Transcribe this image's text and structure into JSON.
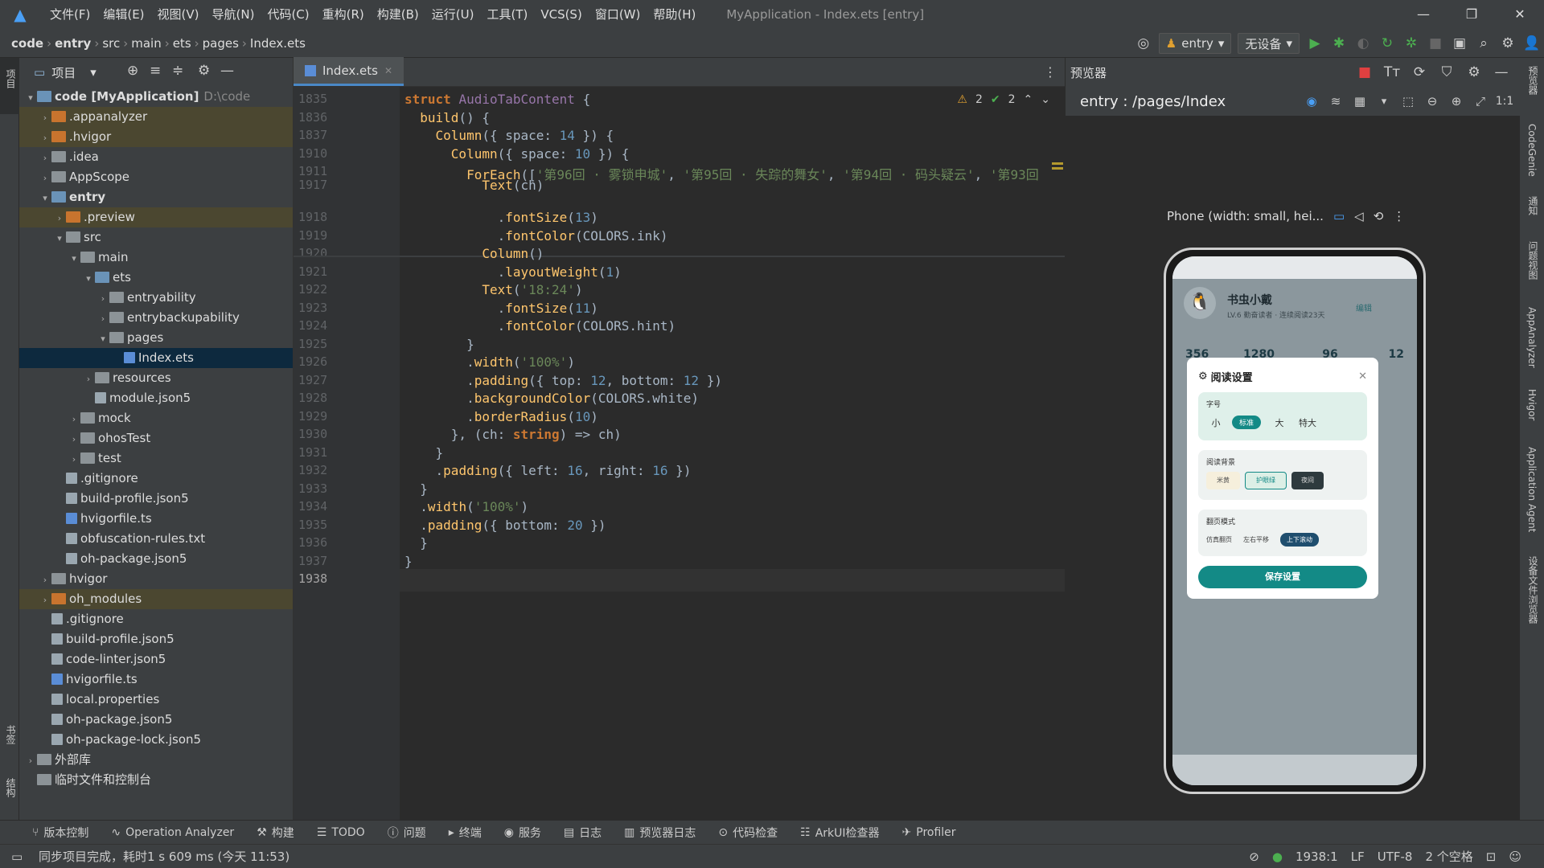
{
  "menubar": {
    "items": [
      "文件(F)",
      "编辑(E)",
      "视图(V)",
      "导航(N)",
      "代码(C)",
      "重构(R)",
      "构建(B)",
      "运行(U)",
      "工具(T)",
      "VCS(S)",
      "窗口(W)",
      "帮助(H)"
    ],
    "title": "MyApplication - Index.ets [entry]"
  },
  "breadcrumb": [
    "code",
    "entry",
    "src",
    "main",
    "ets",
    "pages",
    "Index.ets"
  ],
  "toolbar": {
    "module": "entry",
    "device": "无设备"
  },
  "project": {
    "header": "项目",
    "rows": [
      {
        "indent": 0,
        "arrow": "▾",
        "icon": "fold bl",
        "label": "code [MyApplication]",
        "sub": "D:\\code",
        "bold": true
      },
      {
        "indent": 1,
        "arrow": "›",
        "icon": "fold or",
        "label": ".appanalyzer",
        "hl": true
      },
      {
        "indent": 1,
        "arrow": "›",
        "icon": "fold or",
        "label": ".hvigor",
        "hl": true
      },
      {
        "indent": 1,
        "arrow": "›",
        "icon": "fold",
        "label": ".idea"
      },
      {
        "indent": 1,
        "arrow": "›",
        "icon": "fold",
        "label": "AppScope"
      },
      {
        "indent": 1,
        "arrow": "▾",
        "icon": "fold bl",
        "label": "entry",
        "bold": true
      },
      {
        "indent": 2,
        "arrow": "›",
        "icon": "fold or",
        "label": ".preview",
        "hl": true
      },
      {
        "indent": 2,
        "arrow": "▾",
        "icon": "fold",
        "label": "src"
      },
      {
        "indent": 3,
        "arrow": "▾",
        "icon": "fold",
        "label": "main"
      },
      {
        "indent": 4,
        "arrow": "▾",
        "icon": "fold bl",
        "label": "ets"
      },
      {
        "indent": 5,
        "arrow": "›",
        "icon": "fold",
        "label": "entryability"
      },
      {
        "indent": 5,
        "arrow": "›",
        "icon": "fold",
        "label": "entrybackupability"
      },
      {
        "indent": 5,
        "arrow": "▾",
        "icon": "fold",
        "label": "pages"
      },
      {
        "indent": 6,
        "arrow": "",
        "icon": "file ts",
        "label": "Index.ets",
        "sel": true
      },
      {
        "indent": 4,
        "arrow": "›",
        "icon": "fold",
        "label": "resources"
      },
      {
        "indent": 4,
        "arrow": "",
        "icon": "file",
        "label": "module.json5"
      },
      {
        "indent": 3,
        "arrow": "›",
        "icon": "fold",
        "label": "mock"
      },
      {
        "indent": 3,
        "arrow": "›",
        "icon": "fold",
        "label": "ohosTest"
      },
      {
        "indent": 3,
        "arrow": "›",
        "icon": "fold",
        "label": "test"
      },
      {
        "indent": 2,
        "arrow": "",
        "icon": "file",
        "label": ".gitignore"
      },
      {
        "indent": 2,
        "arrow": "",
        "icon": "file",
        "label": "build-profile.json5"
      },
      {
        "indent": 2,
        "arrow": "",
        "icon": "file ts",
        "label": "hvigorfile.ts"
      },
      {
        "indent": 2,
        "arrow": "",
        "icon": "file",
        "label": "obfuscation-rules.txt"
      },
      {
        "indent": 2,
        "arrow": "",
        "icon": "file",
        "label": "oh-package.json5"
      },
      {
        "indent": 1,
        "arrow": "›",
        "icon": "fold",
        "label": "hvigor"
      },
      {
        "indent": 1,
        "arrow": "›",
        "icon": "fold or",
        "label": "oh_modules",
        "hl": true
      },
      {
        "indent": 1,
        "arrow": "",
        "icon": "file",
        "label": ".gitignore"
      },
      {
        "indent": 1,
        "arrow": "",
        "icon": "file",
        "label": "build-profile.json5"
      },
      {
        "indent": 1,
        "arrow": "",
        "icon": "file",
        "label": "code-linter.json5"
      },
      {
        "indent": 1,
        "arrow": "",
        "icon": "file ts",
        "label": "hvigorfile.ts"
      },
      {
        "indent": 1,
        "arrow": "",
        "icon": "file",
        "label": "local.properties"
      },
      {
        "indent": 1,
        "arrow": "",
        "icon": "file",
        "label": "oh-package.json5"
      },
      {
        "indent": 1,
        "arrow": "",
        "icon": "file",
        "label": "oh-package-lock.json5"
      },
      {
        "indent": 0,
        "arrow": "›",
        "icon": "fold",
        "label": "外部库"
      },
      {
        "indent": 0,
        "arrow": "",
        "icon": "fold",
        "label": "临时文件和控制台"
      }
    ]
  },
  "editor": {
    "tab": "Index.ets",
    "inspections": {
      "warn": "2",
      "ok": "2"
    },
    "lines": [
      "1835",
      "1836",
      "1837",
      "1910",
      "1911",
      "1917",
      "1918",
      "1919",
      "1920",
      "1921",
      "1922",
      "1923",
      "1924",
      "1925",
      "1926",
      "1927",
      "1928",
      "1929",
      "1930",
      "1931",
      "1932",
      "1933",
      "1934",
      "1935",
      "1936",
      "1937",
      "1938"
    ],
    "code": [
      "<span class='kw'>struct</span> <span class='pu'>AudioTabContent</span> {",
      "  <span class='fn'>build</span>() {",
      "    <span class='fn'>Column</span>({ space: <span class='num'>14</span> }) {",
      "      <span class='fn'>Column</span>({ space: <span class='num'>10</span> }) {",
      "        <span class='fn'>ForEach</span>([<span class='str'>'第96回 · 雾锁申城'</span>, <span class='str'>'第95回 · 失踪的舞女'</span>, <span class='str'>'第94回 · 码头疑云'</span>, <span class='str'>'第93回</span>",
      "          <span class='fn'>Text</span>(ch)",
      "            .<span class='dot'>fontSize</span>(<span class='num'>13</span>)",
      "            .<span class='dot'>fontColor</span>(COLORS.ink)",
      "          <span class='fn'>Column</span>()",
      "            .<span class='dot'>layoutWeight</span>(<span class='num'>1</span>)",
      "          <span class='fn'>Text</span>(<span class='str'>'18:24'</span>)",
      "            .<span class='dot'>fontSize</span>(<span class='num'>11</span>)",
      "            .<span class='dot'>fontColor</span>(COLORS.hint)",
      "        }",
      "        .<span class='dot'>width</span>(<span class='str'>'100%'</span>)",
      "        .<span class='dot'>padding</span>({ top: <span class='num'>12</span>, bottom: <span class='num'>12</span> })",
      "        .<span class='dot'>backgroundColor</span>(COLORS.white)",
      "        .<span class='dot'>borderRadius</span>(<span class='num'>10</span>)",
      "      }, (ch: <span class='kw'>string</span>) => ch)",
      "    }",
      "    .<span class='dot'>padding</span>({ left: <span class='num'>16</span>, right: <span class='num'>16</span> })",
      "  }",
      "  .<span class='dot'>width</span>(<span class='str'>'100%'</span>)",
      "  .<span class='dot'>padding</span>({ bottom: <span class='num'>20</span> })",
      "  }",
      "}",
      ""
    ]
  },
  "preview": {
    "header": "预览器",
    "route": "entry : /pages/Index",
    "device_label": "Phone (width: small, hei...",
    "app": {
      "username": "书虫小戴",
      "level": "LV.6 勤奋读者 · 连续阅读23天",
      "edit": "编辑",
      "stats": [
        "356",
        "1280",
        "96",
        "12"
      ],
      "dialog": {
        "title": "阅读设置",
        "font_label": "字号",
        "font_opts": [
          "小",
          "标准",
          "大",
          "特大"
        ],
        "bg_label": "阅读背景",
        "bg_opts": [
          "米黄",
          "护眼绿",
          "夜间"
        ],
        "page_label": "翻页模式",
        "page_opts": [
          "仿真翻页",
          "左右平移",
          "上下滚动"
        ],
        "save": "保存设置"
      }
    }
  },
  "toolwindows": [
    "版本控制",
    "Operation Analyzer",
    "构建",
    "TODO",
    "问题",
    "终端",
    "服务",
    "日志",
    "预览器日志",
    "代码检查",
    "ArkUI检查器",
    "Profiler"
  ],
  "status": {
    "message": "同步项目完成，耗时1 s 609 ms (今天 11:53)",
    "position": "1938:1",
    "lf": "LF",
    "encoding": "UTF-8",
    "indent": "2 个空格"
  },
  "sidebars": {
    "left": [
      "项目",
      "书签",
      "结构"
    ],
    "right": [
      "预览器",
      "CodeGenie",
      "通知",
      "问题视图",
      "AppAnalyzer",
      "Hvigor",
      "Application Agent",
      "设备文件浏览器"
    ]
  }
}
